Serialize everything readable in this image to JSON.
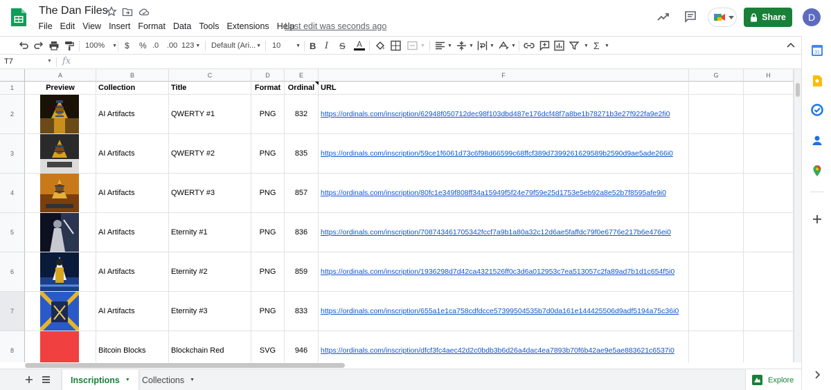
{
  "app": {
    "doc_title": "The Dan Files",
    "last_edit": "Last edit was seconds ago",
    "share_label": "Share",
    "avatar_letter": "D"
  },
  "menu": [
    "File",
    "Edit",
    "View",
    "Insert",
    "Format",
    "Data",
    "Tools",
    "Extensions",
    "Help"
  ],
  "toolbar": {
    "zoom": "100%",
    "currency": "$",
    "percent": "%",
    "dec_decrease": ".0",
    "dec_increase": ".00",
    "more_formats": "123",
    "font_family": "Default (Ari...",
    "font_size": "10"
  },
  "formula_bar": {
    "name_box": "T7",
    "fx": "fx",
    "value": ""
  },
  "grid": {
    "columns": [
      "A",
      "B",
      "C",
      "D",
      "E",
      "F",
      "G",
      "H"
    ],
    "row_numbers": [
      "1",
      "2",
      "3",
      "4",
      "5",
      "6",
      "7",
      "8"
    ],
    "selected_row": "7",
    "headers": [
      "Preview",
      "Collection",
      "Title",
      "Format",
      "Ordinal",
      "URL"
    ],
    "rows": [
      {
        "collection": "AI Artifacts",
        "title": "QWERTY #1",
        "format": "PNG",
        "ordinal": "832",
        "url": "https://ordinals.com/inscription/62948f050712dec98f103dbd487e176dcf48f7a8be1b78271b3e27f922fa9e2fi0",
        "preview": "pharaoh-image"
      },
      {
        "collection": "AI Artifacts",
        "title": "QWERTY #2",
        "format": "PNG",
        "ordinal": "835",
        "url": "https://ordinals.com/inscription/59ce1f6061d73c6f98d66599c68ffcf389d7399261629589b2590d9ae5ade266i0",
        "preview": "pharaoh-image"
      },
      {
        "collection": "AI Artifacts",
        "title": "QWERTY #3",
        "format": "PNG",
        "ordinal": "857",
        "url": "https://ordinals.com/inscription/80fc1e349f808ff34a15949f5f24e79f59e25d1753e5eb92a8e52b7f8595afe9i0",
        "preview": "pharaoh-image"
      },
      {
        "collection": "AI Artifacts",
        "title": "Eternity #1",
        "format": "PNG",
        "ordinal": "836",
        "url": "https://ordinals.com/inscription/708743461705342fccf7a9b1a80a32c12d6ae5faffdc79f0e6776e217b6e476ei0",
        "preview": "dark-figure-image"
      },
      {
        "collection": "AI Artifacts",
        "title": "Eternity #2",
        "format": "PNG",
        "ordinal": "859",
        "url": "https://ordinals.com/inscription/1936298d7d42ca4321526ff0c3d6a012953c7ea513057c2fa89ad7b1d1c654f5i0",
        "preview": "blue-gold-image"
      },
      {
        "collection": "AI Artifacts",
        "title": "Eternity #3",
        "format": "PNG",
        "ordinal": "833",
        "url": "https://ordinals.com/inscription/655a1e1ca758cdfdcce57399504535b7d0da161e144425506d9adf5194a75c36i0",
        "preview": "blue-gold-image"
      },
      {
        "collection": "Bitcoin Blocks",
        "title": "Blockchain Red",
        "format": "SVG",
        "ordinal": "946",
        "url": "https://ordinals.com/inscription/dfcf3fc4aec42d2c0bdb3b6d26a4dac4ea7893b70f6b42ae9e5ae883621c6537i0",
        "preview": "red-square"
      }
    ]
  },
  "sheets": [
    "Inscriptions",
    "Collections"
  ],
  "active_sheet": "Inscriptions",
  "explore_label": "Explore",
  "colors": {
    "brand_green": "#188038",
    "link": "#1155cc",
    "avatar": "#5c6bc0",
    "red_block": "#f04040"
  }
}
